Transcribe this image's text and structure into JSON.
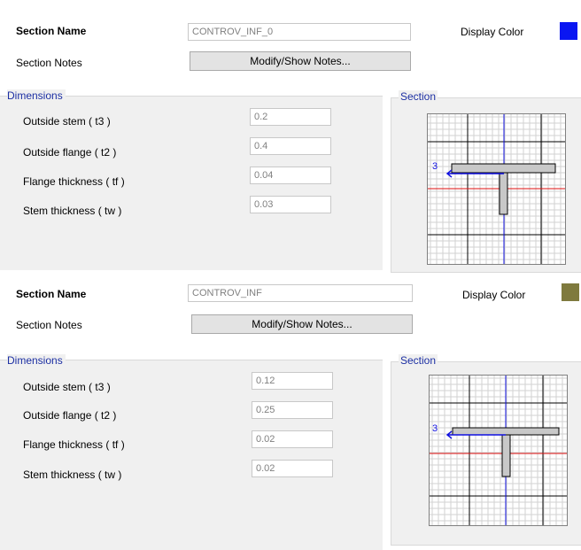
{
  "sections": [
    {
      "section_name_label": "Section Name",
      "section_name_value": "CONTROV_INF_0",
      "display_color_label": "Display Color",
      "display_color": "#0a16f2",
      "section_notes_label": "Section Notes",
      "notes_button_label": "Modify/Show Notes...",
      "dimensions_title": "Dimensions",
      "dims": [
        {
          "label": "Outside stem  ( t3 )",
          "value": "0.2"
        },
        {
          "label": "Outside flange  ( t2 )",
          "value": "0.4"
        },
        {
          "label": "Flange thickness  ( tf )",
          "value": "0.04"
        },
        {
          "label": "Stem thickness  ( tw )",
          "value": "0.03"
        }
      ],
      "section_title": "Section",
      "axis_label": "3"
    },
    {
      "section_name_label": "Section Name",
      "section_name_value": "CONTROV_INF",
      "display_color_label": "Display Color",
      "display_color": "#7f7a3e",
      "section_notes_label": "Section Notes",
      "notes_button_label": "Modify/Show Notes...",
      "dimensions_title": "Dimensions",
      "dims": [
        {
          "label": "Outside stem  ( t3 )",
          "value": "0.12"
        },
        {
          "label": "Outside flange  ( t2 )",
          "value": "0.25"
        },
        {
          "label": "Flange thickness  ( tf )",
          "value": "0.02"
        },
        {
          "label": "Stem thickness  ( tw )",
          "value": "0.02"
        }
      ],
      "section_title": "Section",
      "axis_label": "3"
    }
  ]
}
